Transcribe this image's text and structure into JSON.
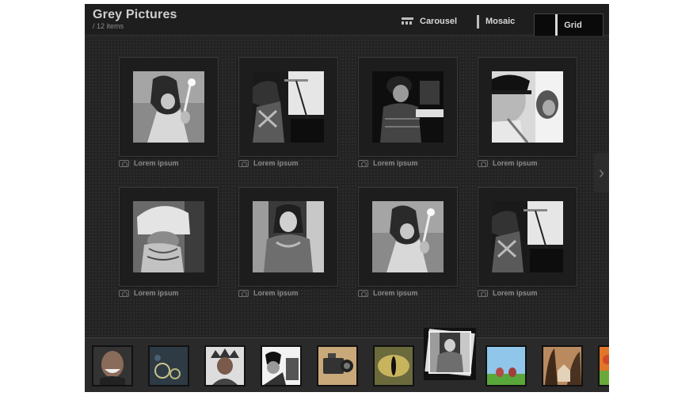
{
  "header": {
    "title": "Grey Pictures",
    "subtitle": "/ 12 items",
    "views": [
      {
        "label": "Carousel",
        "icon": "carousel-icon"
      },
      {
        "label": "Mosaic",
        "icon": "mosaic-icon"
      },
      {
        "label": "Grid",
        "icon": "grid-icon",
        "active": true
      }
    ]
  },
  "grid": {
    "tiles": [
      {
        "caption": "Lorem ipsum",
        "subject": "girl-with-mallet"
      },
      {
        "caption": "Lorem ipsum",
        "subject": "boy-at-microphone"
      },
      {
        "caption": "Lorem ipsum",
        "subject": "boy-playing-keyboard"
      },
      {
        "caption": "Lorem ipsum",
        "subject": "man-with-cap"
      },
      {
        "caption": "Lorem ipsum",
        "subject": "bearded-man-with-hat"
      },
      {
        "caption": "Lorem ipsum",
        "subject": "girl-portrait"
      },
      {
        "caption": "Lorem ipsum",
        "subject": "girl-with-mallet"
      },
      {
        "caption": "Lorem ipsum",
        "subject": "boy-at-microphone"
      }
    ]
  },
  "filmstrip": {
    "thumbs": [
      {
        "subject": "laughing-man"
      },
      {
        "subject": "bubbles"
      },
      {
        "subject": "native-headdress"
      },
      {
        "subject": "musicians"
      },
      {
        "subject": "film-camera"
      },
      {
        "subject": "reptile-eye"
      },
      {
        "subject": "girl-portrait",
        "active": true
      },
      {
        "subject": "sky-and-grass"
      },
      {
        "subject": "house-and-trees"
      },
      {
        "subject": "colorful-partial"
      }
    ]
  },
  "colors": {
    "background": "#232323",
    "header": "#1e1e1e",
    "tile_frame": "#1d1d1d",
    "caption": "#8b8b8b"
  }
}
